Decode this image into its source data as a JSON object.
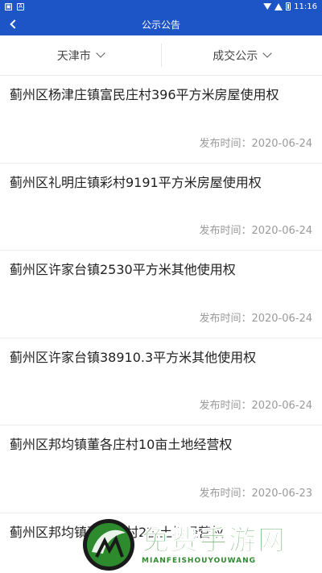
{
  "status_bar": {
    "time": "11:16",
    "left_icons": [
      "notification-icon",
      "a-icon"
    ]
  },
  "app_bar": {
    "title": "公示公告"
  },
  "filters": [
    {
      "label": "天津市"
    },
    {
      "label": "成交公示"
    }
  ],
  "items": [
    {
      "title": "蓟州区杨津庄镇富民庄村396平方米房屋使用权",
      "date": "发布时间：2020-06-24"
    },
    {
      "title": "蓟州区礼明庄镇彩村9191平方米房屋使用权",
      "date": "发布时间：2020-06-24"
    },
    {
      "title": "蓟州区许家台镇2530平方米其他使用权",
      "date": "发布时间：2020-06-24"
    },
    {
      "title": "蓟州区许家台镇38910.3平方米其他使用权",
      "date": "发布时间：2020-06-24"
    },
    {
      "title": "蓟州区邦均镇董各庄村10亩土地经营权",
      "date": "发布时间：2020-06-23"
    },
    {
      "title": "蓟州区邦均镇董各庄村2亩土地经营权",
      "date": ""
    }
  ],
  "watermark": {
    "big": "免费手游网",
    "small": "MIANFEISHOUYOUWANG"
  },
  "colors": {
    "primary": "#1d55c6",
    "watermark": "#2d8b2d"
  }
}
